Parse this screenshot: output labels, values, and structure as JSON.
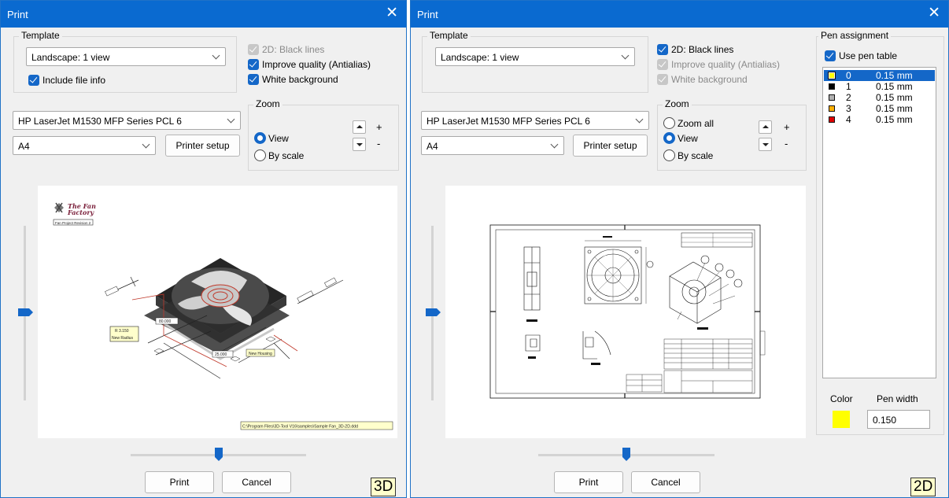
{
  "left": {
    "title": "Print",
    "close_glyph": "✕",
    "template": {
      "group_label": "Template",
      "selected": "Landscape: 1 view",
      "include_file_info": "Include file info"
    },
    "options": {
      "black_lines": "2D: Black lines",
      "antialias": "Improve quality (Antialias)",
      "white_bg": "White background"
    },
    "printer": {
      "selected": "HP LaserJet M1530 MFP Series PCL 6",
      "paper": "A4",
      "setup_button": "Printer setup"
    },
    "zoom": {
      "group_label": "Zoom",
      "view": "View",
      "by_scale": "By scale",
      "plus": "+",
      "minus": "-"
    },
    "preview": {
      "logo_line1": "The Fan",
      "logo_line2": "Factory",
      "logo_sub": "Fan Project Revision 2",
      "callout1": "R 3.150",
      "callout2": "New Radius",
      "dim1": "80.000",
      "dim2": "25.000",
      "tag": "New Housing",
      "path": "C:\\Program Files\\3D-Tool V16\\samples\\Sample Fan_3D-2D.ddd"
    },
    "buttons": {
      "print": "Print",
      "cancel": "Cancel"
    },
    "mode_label": "3D"
  },
  "right": {
    "title": "Print",
    "close_glyph": "✕",
    "template": {
      "group_label": "Template",
      "selected": "Landscape: 1 view"
    },
    "options": {
      "black_lines": "2D: Black lines",
      "antialias": "Improve quality (Antialias)",
      "white_bg": "White background"
    },
    "printer": {
      "selected": "HP LaserJet M1530 MFP Series PCL 6",
      "paper": "A4",
      "setup_button": "Printer setup"
    },
    "zoom": {
      "group_label": "Zoom",
      "zoom_all": "Zoom all",
      "view": "View",
      "by_scale": "By scale",
      "plus": "+",
      "minus": "-"
    },
    "pen": {
      "group_label": "Pen assignment",
      "use_pen_table": "Use pen table",
      "items": [
        {
          "num": "0",
          "width": "0.15 mm",
          "color": "#ffff00"
        },
        {
          "num": "1",
          "width": "0.15 mm",
          "color": "#000000"
        },
        {
          "num": "2",
          "width": "0.15 mm",
          "color": "#b0b0b0"
        },
        {
          "num": "3",
          "width": "0.15 mm",
          "color": "#ffb000"
        },
        {
          "num": "4",
          "width": "0.15 mm",
          "color": "#e00000"
        }
      ],
      "color_label": "Color",
      "pen_width_label": "Pen width",
      "selected_color": "#ffff00",
      "pen_width_value": "0.150"
    },
    "buttons": {
      "print": "Print",
      "cancel": "Cancel"
    },
    "mode_label": "2D"
  }
}
